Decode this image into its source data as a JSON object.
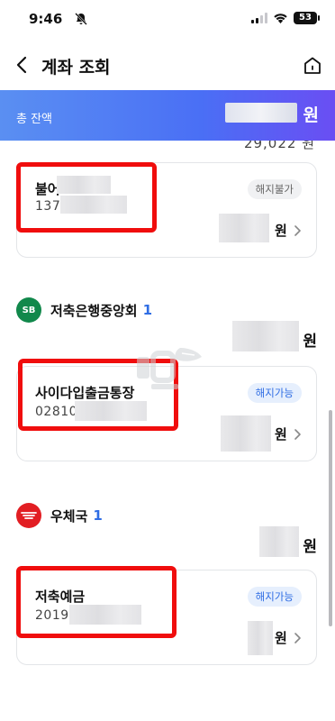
{
  "status_bar": {
    "time": "9:46",
    "battery": "53"
  },
  "header": {
    "title": "계좌 조회"
  },
  "total": {
    "label": "총 잔액",
    "unit": "원"
  },
  "clipped_amount": "29,022 원",
  "accounts": [
    {
      "name": "불어",
      "number": "137",
      "badge": "해지불가",
      "unit": "원"
    },
    {
      "name": "사이다입출금통장",
      "number": "02810",
      "badge": "해지가능",
      "unit": "원"
    },
    {
      "name": "저축예금",
      "number": "20190",
      "badge": "해지가능",
      "unit": "원"
    }
  ],
  "orgs": [
    {
      "name": "저축은행중앙회",
      "count": "1",
      "icon_text": "SB",
      "icon_name": "savings-bank-logo-icon",
      "color": "#11884b",
      "unit": "원"
    },
    {
      "name": "우체국",
      "count": "1",
      "icon_name": "korea-post-logo-icon",
      "color": "#e21e23",
      "unit": "원"
    }
  ],
  "colors": {
    "accent": "#2f6de4",
    "highlight": "#f00d0d",
    "gradient_start": "#5a8ff2",
    "gradient_end": "#6a4ef3"
  }
}
